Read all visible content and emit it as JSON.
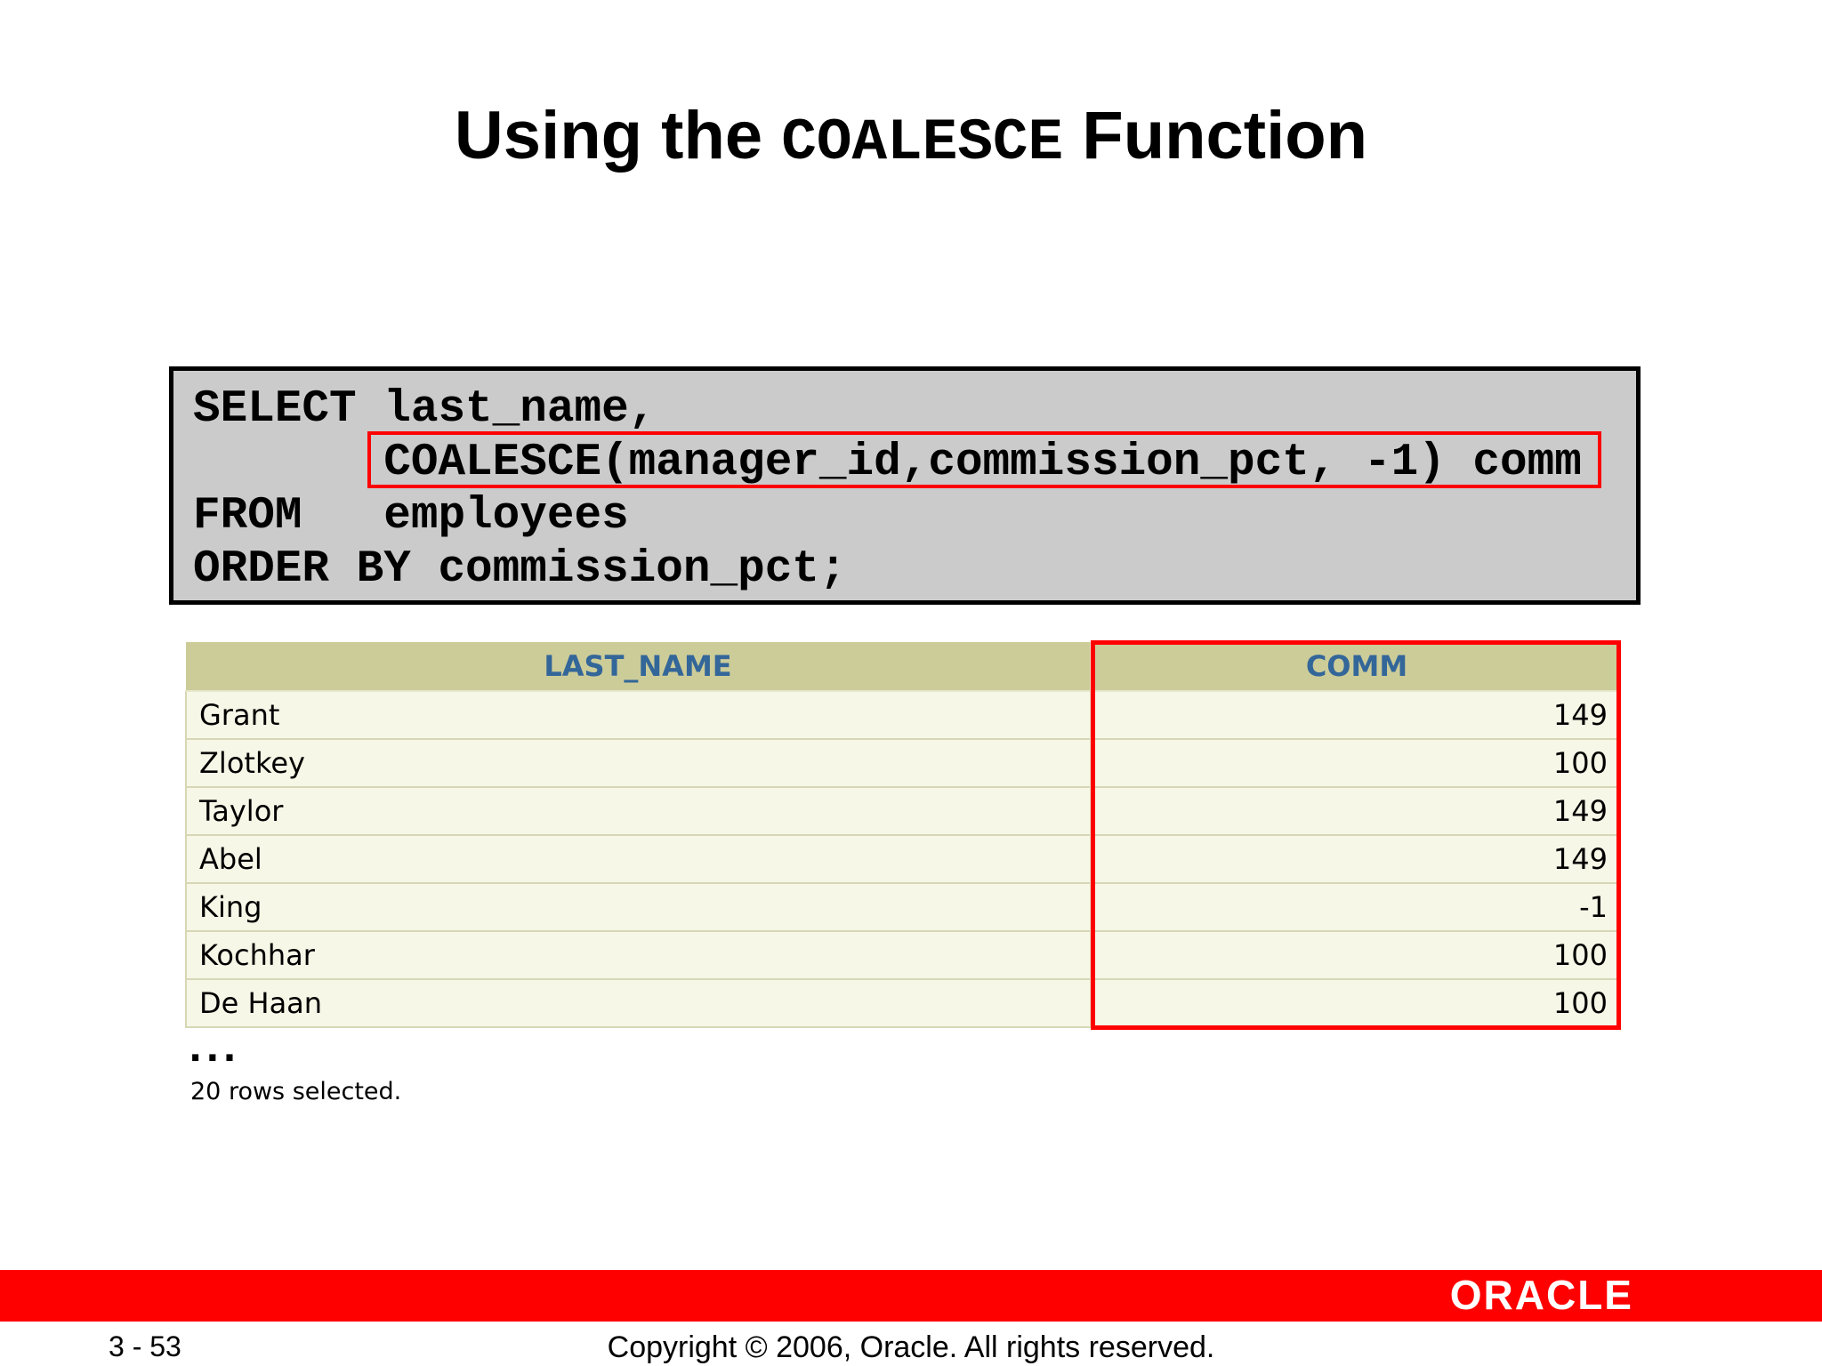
{
  "slide": {
    "title_prefix": "Using the",
    "title_code": "COALESCE",
    "title_suffix": "Function"
  },
  "sql": {
    "lines": [
      "SELECT last_name,",
      "       COALESCE(manager_id,commission_pct, -1) comm",
      "FROM   employees",
      "ORDER BY commission_pct;"
    ]
  },
  "result": {
    "headers": [
      "LAST_NAME",
      "COMM"
    ],
    "rows": [
      [
        "Grant",
        "149"
      ],
      [
        "Zlotkey",
        "100"
      ],
      [
        "Taylor",
        "149"
      ],
      [
        "Abel",
        "149"
      ],
      [
        "King",
        "-1"
      ],
      [
        "Kochhar",
        "100"
      ],
      [
        "De Haan",
        "100"
      ]
    ],
    "ellipsis": "...",
    "rows_selected": "20 rows selected."
  },
  "footer": {
    "slide_number": "3 - 53",
    "copyright": "Copyright © 2006, Oracle. All rights reserved.",
    "logo_text": "ORACLE",
    "band_color": "#ff0000"
  }
}
